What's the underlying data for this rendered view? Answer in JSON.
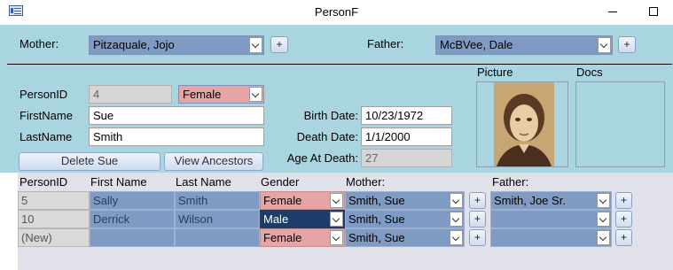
{
  "window": {
    "title": "PersonF"
  },
  "header": {
    "mother_label": "Mother:",
    "mother_value": "Pitzaquale, Jojo",
    "father_label": "Father:",
    "father_value": "McBVee, Dale",
    "plus": "+"
  },
  "detail": {
    "person_id_label": "PersonID",
    "person_id_value": "4",
    "gender_value": "Female",
    "first_name_label": "FirstName",
    "first_name_value": "Sue",
    "last_name_label": "LastName",
    "last_name_value": "Smith",
    "birth_date_label": "Birth Date:",
    "birth_date_value": "10/23/1972",
    "death_date_label": "Death Date:",
    "death_date_value": "1/1/2000",
    "age_at_death_label": "Age At Death:",
    "age_at_death_value": "27",
    "picture_label": "Picture",
    "docs_label": "Docs",
    "delete_button": "Delete Sue",
    "ancestors_button": "View Ancestors"
  },
  "subform": {
    "headers": [
      "PersonID",
      "First Name",
      "Last Name",
      "Gender",
      "Mother:",
      "Father:"
    ],
    "plus": "+",
    "rows": [
      {
        "id": "5",
        "first": "Sally",
        "last": "Smith",
        "gender": "Female",
        "mother": "Smith, Sue",
        "father": "Smith, Joe Sr."
      },
      {
        "id": "10",
        "first": "Derrick",
        "last": "Wilson",
        "gender": "Male",
        "mother": "Smith, Sue",
        "father": ""
      },
      {
        "id": "(New)",
        "first": "",
        "last": "",
        "gender": "Female",
        "mother": "Smith, Sue",
        "father": ""
      }
    ]
  },
  "colors": {
    "form_background": "#a9d5e0",
    "combo_blue": "#7f9bc4",
    "gender_pink": "#e6a4a4",
    "selected_navy": "#1c3c6a"
  }
}
